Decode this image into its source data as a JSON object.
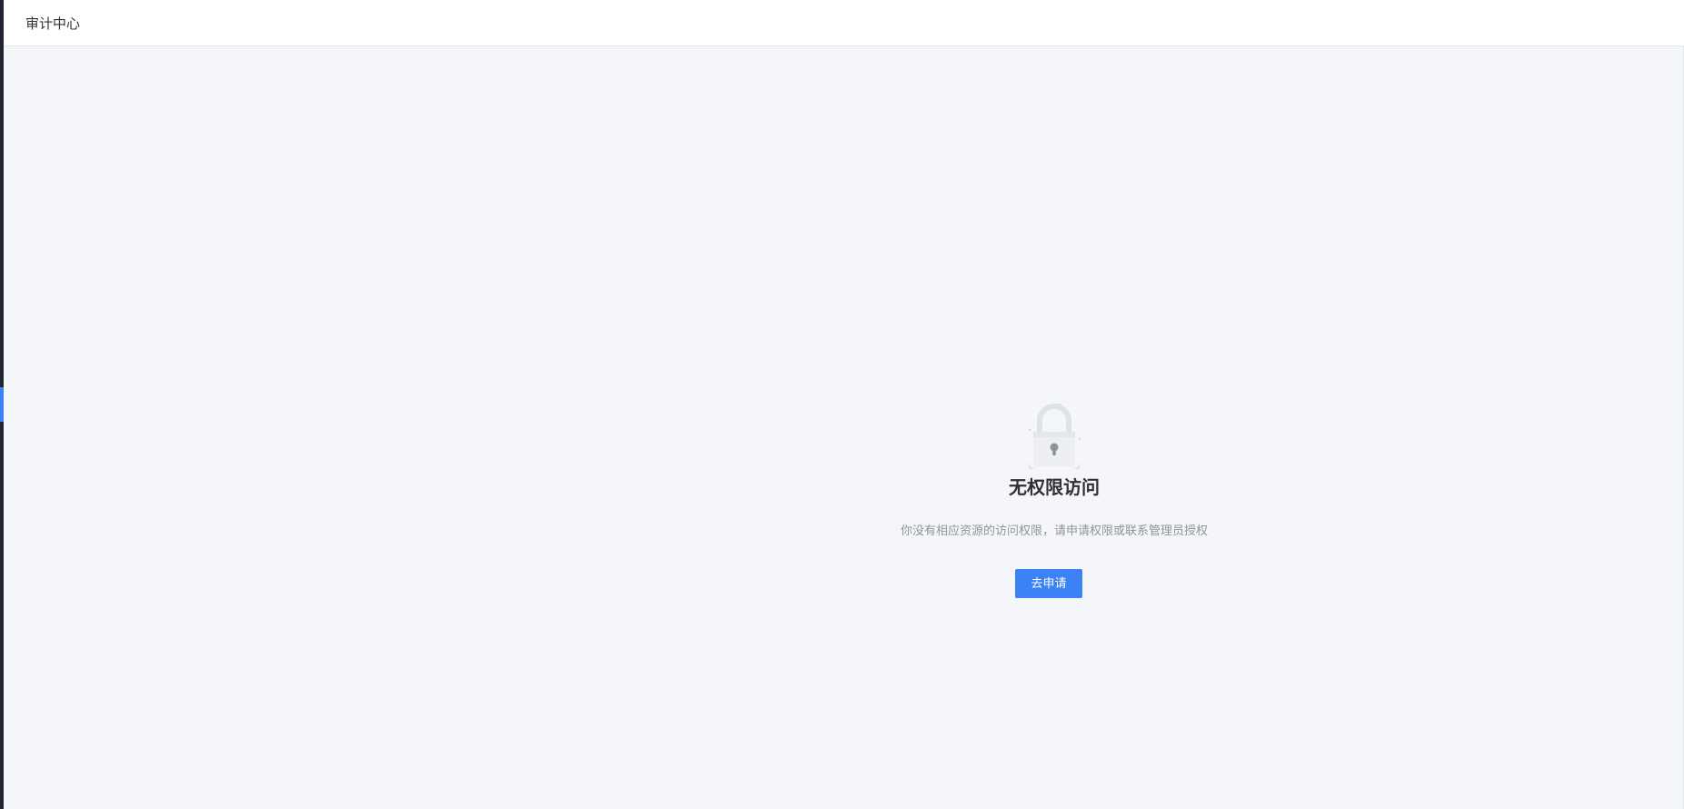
{
  "header": {
    "title": "审计中心"
  },
  "error": {
    "icon": "lock-icon",
    "title": "无权限访问",
    "description": "你没有相应资源的访问权限，请申请权限或联系管理员授权",
    "apply_label": "去申请"
  },
  "colors": {
    "accent": "#3b82f6",
    "background": "#f4f6f9",
    "rail": "#1f2430"
  }
}
